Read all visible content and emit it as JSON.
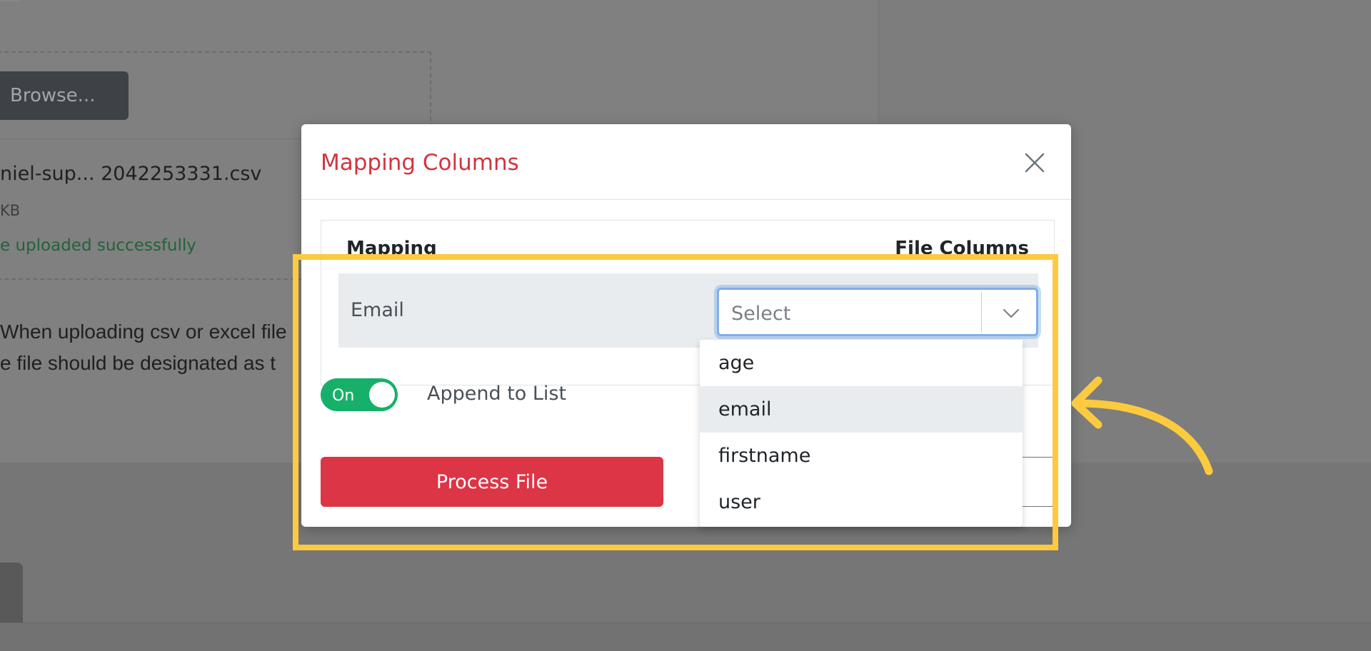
{
  "background": {
    "browse_label": "Browse...",
    "file_name": "niel-sup... 2042253331.csv",
    "file_size": "KB",
    "file_status": "e uploaded successfully",
    "info_line_1": "When uploading csv or excel file",
    "info_line_2": "e file should be designated as t"
  },
  "modal": {
    "title": "Mapping Columns",
    "table": {
      "header_mapping": "Mapping",
      "header_file_columns": "File Columns",
      "rows": [
        {
          "label": "Email",
          "select_placeholder": "Select"
        }
      ]
    },
    "dropdown_options": [
      "age",
      "email",
      "firstname",
      "user"
    ],
    "dropdown_active_index": 1,
    "toggle": {
      "label": "On",
      "state": true
    },
    "append_label": "Append to List",
    "process_button": "Process File"
  },
  "colors": {
    "title_red": "#d2343f",
    "process_red": "#dc3545",
    "toggle_green": "#17b06a",
    "highlight_yellow": "#fbca3f",
    "focus_blue": "#80aee6"
  },
  "icons": {
    "close": "close-icon",
    "chevron": "chevron-down-icon",
    "annotation_arrow": "curved-arrow-icon"
  }
}
